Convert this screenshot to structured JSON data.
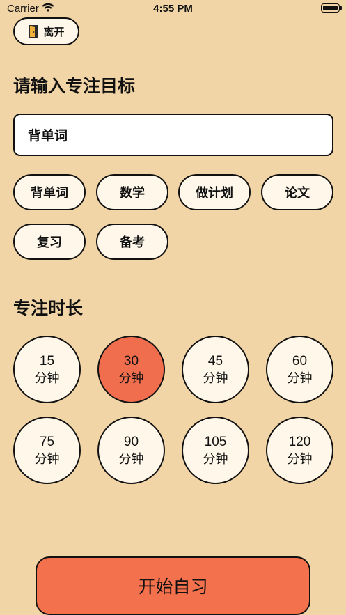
{
  "status": {
    "carrier": "Carrier",
    "time": "4:55 PM"
  },
  "header": {
    "leave_label": "离开"
  },
  "goal": {
    "title": "请输入专注目标",
    "input_value": "背单词",
    "tags": [
      "背单词",
      "数学",
      "做计划",
      "论文",
      "复习",
      "备考"
    ]
  },
  "duration": {
    "title": "专注时长",
    "unit": "分钟",
    "options": [
      "15",
      "30",
      "45",
      "60",
      "75",
      "90",
      "105",
      "120"
    ],
    "selected": "30"
  },
  "start_label": "开始自习",
  "colors": {
    "background": "#f2d5a6",
    "chip": "#fff8ea",
    "accent": "#f06e4e",
    "start_button": "#f3714c"
  }
}
